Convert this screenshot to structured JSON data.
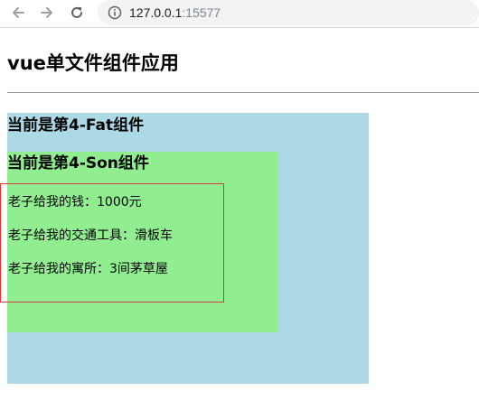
{
  "browser": {
    "url_host": "127.0.0.1",
    "url_port": ":15577",
    "icons": [
      "back-arrow-icon",
      "forward-arrow-icon",
      "reload-icon",
      "info-icon"
    ]
  },
  "page": {
    "title": "vue单文件组件应用",
    "fat": {
      "heading": "当前是第4-Fat组件",
      "color": "#add8e6"
    },
    "son": {
      "heading": "当前是第4-Son组件",
      "color": "#90ee90",
      "gifts": [
        "老子给我的钱：1000元",
        "老子给我的交通工具：滑板车",
        "老子给我的寓所：3间茅草屋"
      ],
      "border_color": "#d43a3a"
    }
  }
}
